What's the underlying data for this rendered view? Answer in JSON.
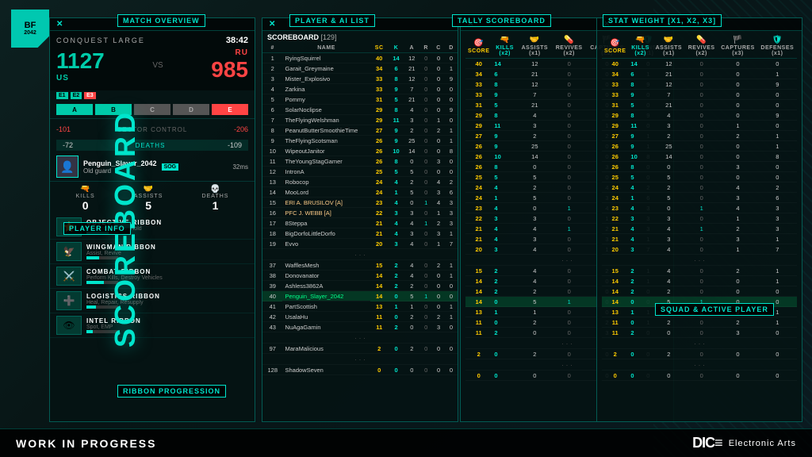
{
  "app": {
    "title": "Scoreboard",
    "bf_logo": "BF\n2042",
    "wip": "WORK IN PROGRESS",
    "dice_ea": "DICE Electronic Arts"
  },
  "panels": {
    "match_overview": {
      "title": "MATCH OVERVIEW",
      "close": "X",
      "conquest": "CONQUEST LARGE",
      "timer": "38:42",
      "score_us": "1127",
      "score_ru": "985",
      "team_us": "US",
      "team_ru": "RU",
      "sectors": [
        "A",
        "B",
        "C",
        "D",
        "E"
      ],
      "e_indicators": [
        "E1",
        "E2",
        "E3"
      ],
      "sector_control_label": "SECTOR CONTROL",
      "sector_control_us": "-101",
      "sector_control_ru": "-206",
      "deaths_label": "DEATHS",
      "deaths_us": "-72",
      "deaths_ru": "-109",
      "player_name": "Penguin_Slayer_2042",
      "player_rank": "Old guard",
      "squad": "SOG",
      "ping": "32ms",
      "kills_label": "KILLS",
      "kills_val": "0",
      "assists_label": "ASSISTS",
      "assists_val": "5",
      "deaths_stat_label": "DEATHS",
      "deaths_stat_val": "1"
    },
    "player_info": {
      "title": "PLAYER INFO"
    },
    "ribbons": {
      "title": "RIBBON PROGRESSION",
      "items": [
        {
          "name": "OBJECTIVE RIBBON",
          "sub": "Capture, Defend, Hold",
          "fill": 70
        },
        {
          "name": "WINGMAN RIBBON",
          "sub": "Assist, Revive",
          "fill": 40
        },
        {
          "name": "COMBAT RIBBON",
          "sub": "Perform Kills, Destroy Vehicles",
          "fill": 55
        },
        {
          "name": "LOGISTICS RIBBON",
          "sub": "Heal, Repair, Resupply",
          "fill": 30
        },
        {
          "name": "INTEL RIBBON",
          "sub": "Spot, EMP",
          "fill": 20
        }
      ]
    },
    "scoreboard": {
      "title": "SCOREBOARD",
      "count": "[129]",
      "close": "X",
      "columns": [
        "#",
        "",
        "SCORE",
        "KILLS (x2)",
        "ASSISTS (x1)",
        "REVIVES (x2)",
        "CAPTURES (x3)",
        "DEFENSES (x1)"
      ],
      "rows": [
        {
          "rank": 1,
          "name": "RyingSquirrel",
          "score": 40,
          "kills": 14,
          "assists": 12,
          "revives": 0,
          "captures": 0,
          "defenses": 0,
          "highlight": false
        },
        {
          "rank": 2,
          "name": "Garait_Greymaine",
          "score": 34,
          "kills": 6,
          "assists": 21,
          "revives": 0,
          "captures": 0,
          "defenses": 1,
          "highlight": false
        },
        {
          "rank": 3,
          "name": "Mister_Explosivo",
          "score": 33,
          "kills": 8,
          "assists": 12,
          "revives": 0,
          "captures": 0,
          "defenses": 9,
          "highlight": false
        },
        {
          "rank": 4,
          "name": "Zarkina",
          "score": 33,
          "kills": 9,
          "assists": 7,
          "revives": 0,
          "captures": 0,
          "defenses": 0,
          "highlight": false
        },
        {
          "rank": 5,
          "name": "Pommy",
          "score": 31,
          "kills": 5,
          "assists": 21,
          "revives": 0,
          "captures": 0,
          "defenses": 0,
          "highlight": false
        },
        {
          "rank": 6,
          "name": "SolarNoclipse",
          "score": 29,
          "kills": 8,
          "assists": 4,
          "revives": 0,
          "captures": 0,
          "defenses": 9,
          "highlight": false
        },
        {
          "rank": 7,
          "name": "TheFlyingWelshman",
          "score": 29,
          "kills": 11,
          "assists": 3,
          "revives": 0,
          "captures": 1,
          "defenses": 0,
          "highlight": false
        },
        {
          "rank": 8,
          "name": "PeanutButterSmoothieTime",
          "score": 27,
          "kills": 9,
          "assists": 2,
          "revives": 0,
          "captures": 2,
          "defenses": 1,
          "highlight": false
        },
        {
          "rank": 9,
          "name": "TheFlyingScotsman",
          "score": 26,
          "kills": 9,
          "assists": 25,
          "revives": 0,
          "captures": 0,
          "defenses": 1,
          "highlight": false
        },
        {
          "rank": 10,
          "name": "WipeoutJanitor",
          "score": 26,
          "kills": 10,
          "assists": 14,
          "revives": 0,
          "captures": 0,
          "defenses": 8,
          "highlight": false
        },
        {
          "rank": 11,
          "name": "TheYoungStagGamer",
          "score": 26,
          "kills": 8,
          "assists": 0,
          "revives": 0,
          "captures": 3,
          "defenses": 0,
          "highlight": false
        },
        {
          "rank": 12,
          "name": "IntronA",
          "score": 25,
          "kills": 5,
          "assists": 5,
          "revives": 0,
          "captures": 0,
          "defenses": 0,
          "highlight": false
        },
        {
          "rank": 13,
          "name": "Robocop",
          "score": 24,
          "kills": 4,
          "assists": 2,
          "revives": 0,
          "captures": 4,
          "defenses": 2,
          "highlight": false
        },
        {
          "rank": 14,
          "name": "MooLord",
          "score": 24,
          "kills": 1,
          "assists": 5,
          "revives": 0,
          "captures": 3,
          "defenses": 6,
          "highlight": false
        },
        {
          "rank": 15,
          "name": "ERI A. BRUSILOV [A]",
          "score": 23,
          "kills": 4,
          "assists": 0,
          "revives": 1,
          "captures": 4,
          "defenses": 3,
          "highlight": false
        },
        {
          "rank": 16,
          "name": "PFC J. WEBB [A]",
          "score": 22,
          "kills": 3,
          "assists": 3,
          "revives": 0,
          "captures": 1,
          "defenses": 3,
          "highlight": false
        },
        {
          "rank": 17,
          "name": "8Steppa",
          "score": 21,
          "kills": 4,
          "assists": 4,
          "revives": 1,
          "captures": 2,
          "defenses": 3,
          "highlight": false
        },
        {
          "rank": 18,
          "name": "BigDorfoLittleDorfo",
          "score": 21,
          "kills": 4,
          "assists": 3,
          "revives": 0,
          "captures": 3,
          "defenses": 1,
          "highlight": false
        },
        {
          "rank": 19,
          "name": "Evvo",
          "score": 20,
          "kills": 3,
          "assists": 4,
          "revives": 0,
          "captures": 1,
          "defenses": 7,
          "highlight": false
        },
        {
          "rank": 37,
          "name": "WafflesMesh",
          "score": 15,
          "kills": 2,
          "assists": 4,
          "revives": 0,
          "captures": 2,
          "defenses": 1,
          "highlight": false,
          "dots": true
        },
        {
          "rank": 38,
          "name": "Donovanator",
          "score": 14,
          "kills": 2,
          "assists": 4,
          "revives": 0,
          "captures": 0,
          "defenses": 1,
          "highlight": false
        },
        {
          "rank": 39,
          "name": "Ashless3862A",
          "score": 14,
          "kills": 2,
          "assists": 2,
          "revives": 0,
          "captures": 0,
          "defenses": 0,
          "highlight": false
        },
        {
          "rank": 40,
          "name": "Penguin_Slayer_2042",
          "score": 14,
          "kills": 0,
          "assists": 5,
          "revives": 1,
          "captures": 0,
          "defenses": 0,
          "highlight": true
        },
        {
          "rank": 41,
          "name": "PartScottish",
          "score": 13,
          "kills": 1,
          "assists": 1,
          "revives": 0,
          "captures": 0,
          "defenses": 1,
          "highlight": false
        },
        {
          "rank": 42,
          "name": "UsalaHu",
          "score": 11,
          "kills": 0,
          "assists": 2,
          "revives": 0,
          "captures": 2,
          "defenses": 1,
          "highlight": false
        },
        {
          "rank": 43,
          "name": "NuAgaGamin",
          "score": 11,
          "kills": 2,
          "assists": 0,
          "revives": 0,
          "captures": 3,
          "defenses": 0,
          "highlight": false
        },
        {
          "rank": 97,
          "name": "MaraMalicious",
          "score": 2,
          "kills": 0,
          "assists": 2,
          "revives": 0,
          "captures": 0,
          "defenses": 0,
          "highlight": false,
          "dots": true
        },
        {
          "rank": 128,
          "name": "ShadowSeven",
          "score": 0,
          "kills": 0,
          "assists": 0,
          "revives": 0,
          "captures": 0,
          "defenses": 0,
          "highlight": false,
          "dots": true
        }
      ]
    },
    "squad_active": {
      "title": "SQUAD & ACTIVE PLAYER",
      "close": "X"
    }
  },
  "tally": {
    "title": "TALLY SCOREBOARD",
    "close": "X"
  },
  "stat_weight": {
    "title": "STAT WEIGHT [X1, X2, X3]",
    "close": "X"
  }
}
